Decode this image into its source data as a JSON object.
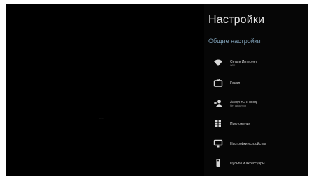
{
  "colors": {
    "background": "#000000",
    "panel": "#060606",
    "accent": "#7fa0b7",
    "text": "#cfcfcf"
  },
  "tv": {
    "watermark": "HDMI"
  },
  "panel": {
    "title": "Настройки",
    "subtitle": "Общие настройки",
    "items": [
      {
        "icon": "wifi-icon",
        "label": "Сеть и Интернет",
        "sub": "WIFI"
      },
      {
        "icon": "tv-icon",
        "label": "Канал",
        "sub": ""
      },
      {
        "icon": "accounts-icon",
        "label": "Аккаунты и вход",
        "sub": "Нет аккаунтов"
      },
      {
        "icon": "apps-icon",
        "label": "Приложения",
        "sub": ""
      },
      {
        "icon": "display-icon",
        "label": "Настройки устройства",
        "sub": ""
      },
      {
        "icon": "remote-icon",
        "label": "Пульты и аксессуары",
        "sub": ""
      }
    ]
  }
}
